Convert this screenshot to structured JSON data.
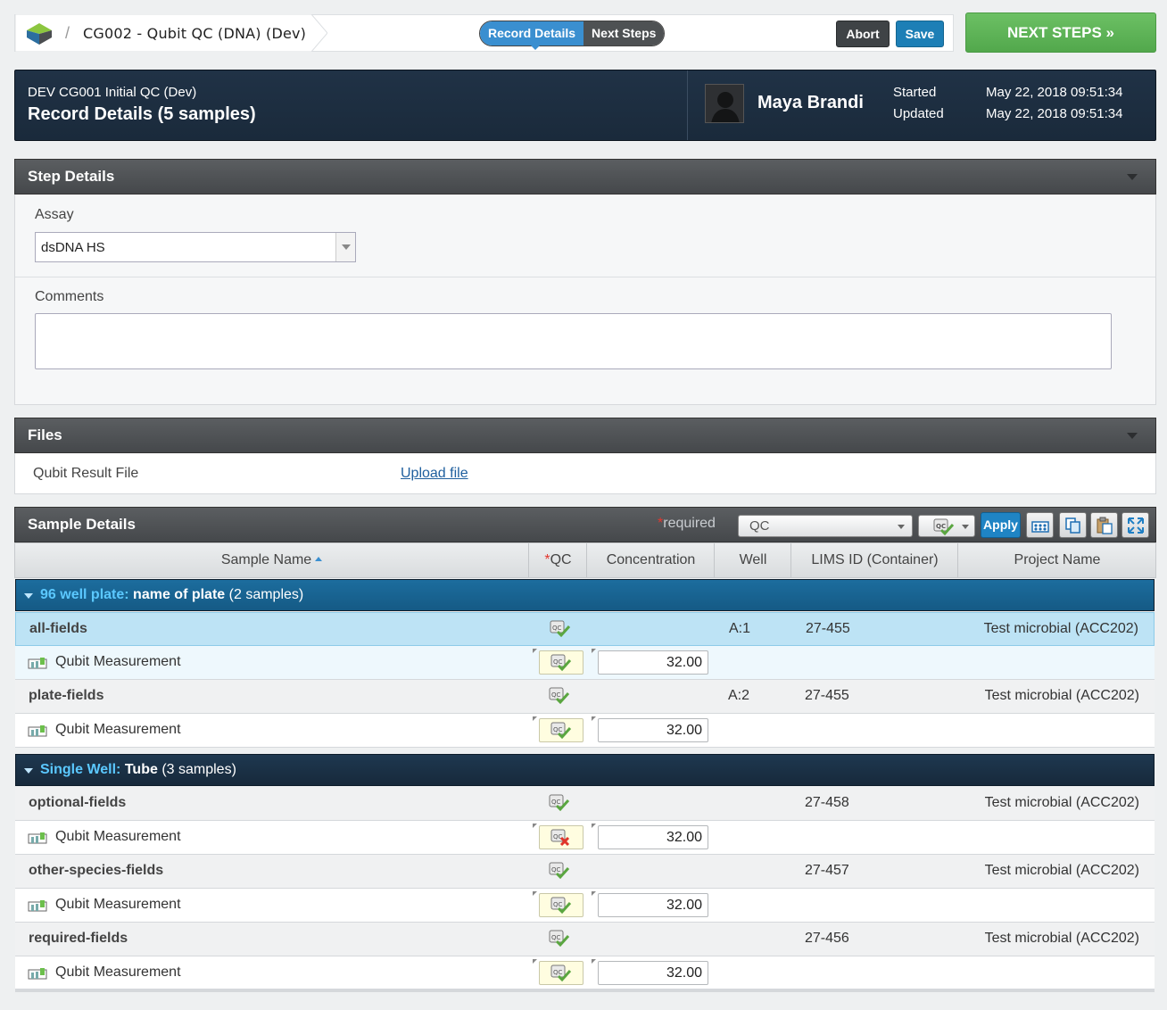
{
  "topbar": {
    "breadcrumb_sep": "/",
    "step_title": "CG002 - Qubit QC (DNA) (Dev)",
    "seg_record": "Record Details",
    "seg_next": "Next Steps",
    "abort_label": "Abort",
    "save_label": "Save",
    "next_steps_label": "NEXT STEPS »"
  },
  "banner": {
    "protocol": "DEV CG001 Initial QC (Dev)",
    "title_main": "Record Details",
    "title_count": "(5 samples)",
    "user": "Maya Brandi",
    "started_label": "Started",
    "updated_label": "Updated",
    "started_value": "May 22, 2018 09:51:34",
    "updated_value": "May 22, 2018 09:51:34"
  },
  "step_details": {
    "title": "Step Details",
    "assay_label": "Assay",
    "assay_value": "dsDNA HS",
    "comments_label": "Comments",
    "comments_value": ""
  },
  "files": {
    "title": "Files",
    "file_label": "Qubit Result File",
    "upload_label": "Upload file"
  },
  "sample_details": {
    "title": "Sample Details",
    "required_star": "*",
    "required_text": "required",
    "qc_select_value": "QC",
    "apply_label": "Apply",
    "columns": {
      "sample_name": "Sample Name",
      "qc_star": "*",
      "qc": "QC",
      "concentration": "Concentration",
      "well": "Well",
      "lims_id": "LIMS ID (Container)",
      "project_name": "Project Name"
    },
    "groups": [
      {
        "type": "96 well plate:",
        "name": "name of plate",
        "count": "(2 samples)",
        "samples": [
          {
            "name": "all-fields",
            "well": "A:1",
            "lims": "27-455",
            "project": "Test microbial (ACC202)",
            "measurement": "Qubit Measurement",
            "concentration": "32.00",
            "qc": "pass"
          },
          {
            "name": "plate-fields",
            "well": "A:2",
            "lims": "27-455",
            "project": "Test microbial (ACC202)",
            "measurement": "Qubit Measurement",
            "concentration": "32.00",
            "qc": "pass"
          }
        ]
      },
      {
        "type": "Single Well:",
        "name": "Tube",
        "count": "(3 samples)",
        "samples": [
          {
            "name": "optional-fields",
            "well": "",
            "lims": "27-458",
            "project": "Test microbial (ACC202)",
            "measurement": "Qubit Measurement",
            "concentration": "32.00",
            "qc": "fail"
          },
          {
            "name": "other-species-fields",
            "well": "",
            "lims": "27-457",
            "project": "Test microbial (ACC202)",
            "measurement": "Qubit Measurement",
            "concentration": "32.00",
            "qc": "pass"
          },
          {
            "name": "required-fields",
            "well": "",
            "lims": "27-456",
            "project": "Test microbial (ACC202)",
            "measurement": "Qubit Measurement",
            "concentration": "32.00",
            "qc": "pass"
          }
        ]
      }
    ]
  },
  "colors": {
    "accent_blue": "#3a8fd0",
    "save_blue": "#1d7fb6",
    "next_green": "#5cb85c",
    "banner_navy": "#1e2f42",
    "group_highlight": "#5bc8ff",
    "required_red": "#e3372f"
  }
}
